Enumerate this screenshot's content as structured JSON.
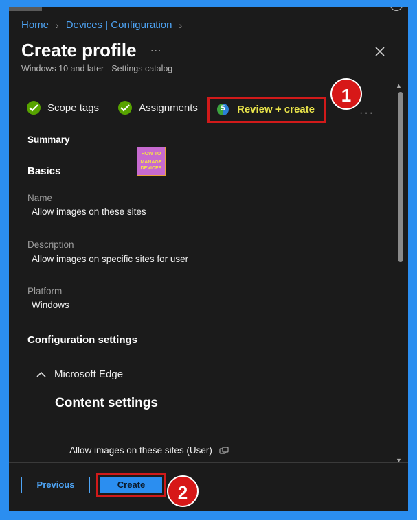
{
  "breadcrumb": {
    "home": "Home",
    "devices": "Devices | Configuration"
  },
  "header": {
    "title": "Create profile",
    "more": "...",
    "subtitle": "Windows 10 and later - Settings catalog"
  },
  "steps": {
    "items": [
      {
        "label": "Scope tags",
        "status": "complete"
      },
      {
        "label": "Assignments",
        "status": "complete"
      }
    ],
    "current": {
      "label": "Review + create",
      "number": "5"
    },
    "more": "···"
  },
  "annotations": {
    "badge1": "1",
    "badge2": "2"
  },
  "logo": {
    "line1": "HOW TO",
    "line2": "MANAGE",
    "line3": "DEVICES"
  },
  "summary": {
    "heading": "Summary",
    "basics_heading": "Basics",
    "name_label": "Name",
    "name_value": "Allow images on these sites",
    "description_label": "Description",
    "description_value": "Allow images on specific sites for user",
    "platform_label": "Platform",
    "platform_value": "Windows",
    "config_heading": "Configuration settings",
    "category": "Microsoft Edge",
    "subcategory": "Content settings",
    "setting_label": "Allow images on these sites (User)"
  },
  "footer": {
    "previous_label": "Previous",
    "create_label": "Create"
  },
  "colors": {
    "accent": "#2b8ef0",
    "panel": "#1b1b1b",
    "highlight": "#d11a1a",
    "check": "#57a300",
    "review_text": "#e8e34a"
  }
}
